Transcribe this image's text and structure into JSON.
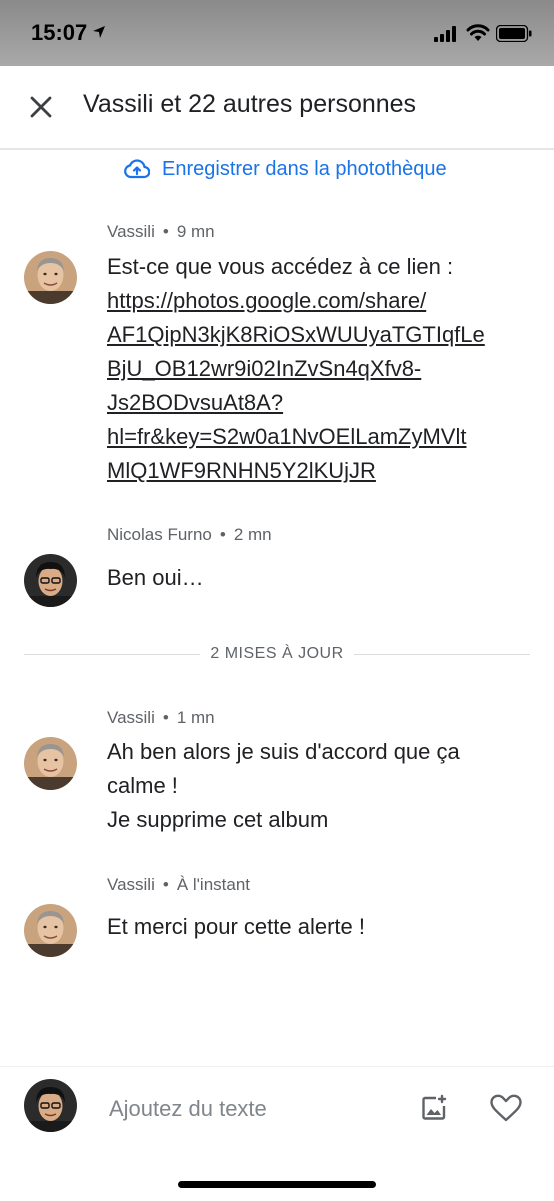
{
  "status_bar": {
    "time": "15:07"
  },
  "header": {
    "title": "Vassili et 22 autres personnes"
  },
  "save_link": {
    "label": "Enregistrer dans la photothèque"
  },
  "messages": [
    {
      "author": "Vassili",
      "time": "9 mn",
      "avatar": "avatar-vassili",
      "text_intro": "Est-ce que vous accédez à ce lien :",
      "link_lines": [
        "https://photos.google.com/share/",
        "AF1QipN3kjK8RiOSxWUUyaTGTIqfLe",
        "BjU_OB12wr9i02InZvSn4qXfv8-",
        "Js2BODvsuAt8A?",
        "hl=fr&key=S2w0a1NvOElLamZyMVlt",
        "MlQ1WF9RNHN5Y2lKUjJR"
      ]
    },
    {
      "author": "Nicolas Furno",
      "time": "2 mn",
      "avatar": "avatar-nicolas",
      "lines": [
        "Ben oui…"
      ]
    },
    {
      "author": "Vassili",
      "time": "1 mn",
      "avatar": "avatar-vassili",
      "lines": [
        "Ah ben alors je suis d'accord que ça",
        "calme !",
        "Je supprime cet album"
      ]
    },
    {
      "author": "Vassili",
      "time": "À l'instant",
      "avatar": "avatar-vassili",
      "lines": [
        "Et merci pour cette alerte !"
      ]
    }
  ],
  "updates_divider": {
    "label": "2 MISES À JOUR"
  },
  "composer": {
    "placeholder": "Ajoutez du texte"
  },
  "icons": {
    "close": "close-icon",
    "cloud_upload": "cloud-upload-icon",
    "add_photo": "add-photo-icon",
    "like": "heart-icon"
  },
  "colors": {
    "accent": "#1a73e8",
    "text": "#202124",
    "meta": "#5f6368"
  }
}
